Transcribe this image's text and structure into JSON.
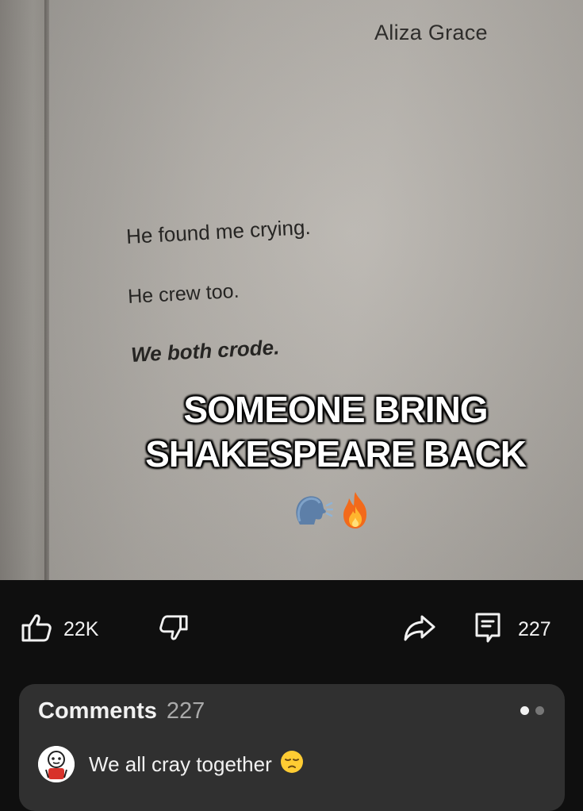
{
  "video": {
    "author": "Aliza Grace",
    "poem_lines": [
      "He found me crying.",
      "He crew too.",
      "We both crode."
    ],
    "caption_lines": [
      "SOMEONE BRING",
      "SHAKESPEARE BACK"
    ],
    "caption_emojis": [
      "speaking-head-emoji",
      "fire-emoji"
    ]
  },
  "actions": {
    "like_count": "22K",
    "comment_count": "227",
    "icons": [
      "thumbs-up-icon",
      "thumbs-down-icon",
      "share-icon",
      "comments-icon"
    ]
  },
  "comments": {
    "title": "Comments",
    "count": "227",
    "pager": {
      "total": 2,
      "active": 1
    },
    "top_comment": {
      "text": "We all cray together",
      "emoji": "pensive-face-emoji",
      "avatar": "cartoon-avatar"
    }
  },
  "colors": {
    "background": "#0f0f0f",
    "panel": "#303030",
    "text": "#f1f1f1",
    "muted": "#aaaaaa"
  }
}
